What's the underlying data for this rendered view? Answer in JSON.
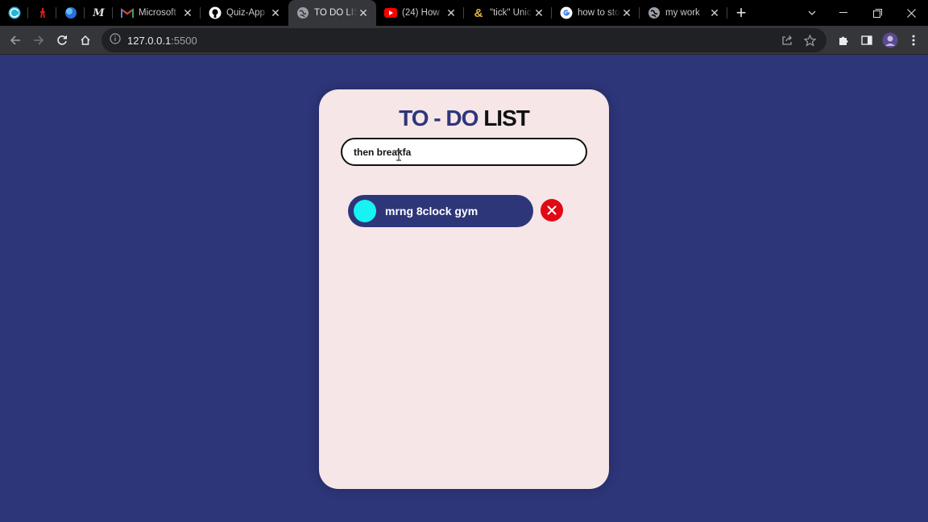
{
  "browser": {
    "tabs": [
      {
        "title": "Microsoft",
        "icon": "gmail-icon"
      },
      {
        "title": "Quiz-App",
        "icon": "github-icon"
      },
      {
        "title": "TO DO LIST",
        "icon": "globe-icon",
        "active": true
      },
      {
        "title": "(24) How",
        "icon": "youtube-icon"
      },
      {
        "title": "\"tick\" Unic",
        "icon": "ampersand-icon"
      },
      {
        "title": "how to sto",
        "icon": "google-icon"
      },
      {
        "title": "my work",
        "icon": "globe-icon"
      }
    ],
    "url_host": "127.0.0.1",
    "url_port": ":5500"
  },
  "app": {
    "title_part1": "TO - DO",
    "title_part2": "LIST",
    "input_value": "then breakfa",
    "todos": [
      {
        "text": "mrng 8clock gym"
      }
    ],
    "colors": {
      "background": "#2e367a",
      "card": "#f6e6e8",
      "item": "#2e367a",
      "check": "#17f2f2",
      "delete": "#e00a14"
    }
  }
}
